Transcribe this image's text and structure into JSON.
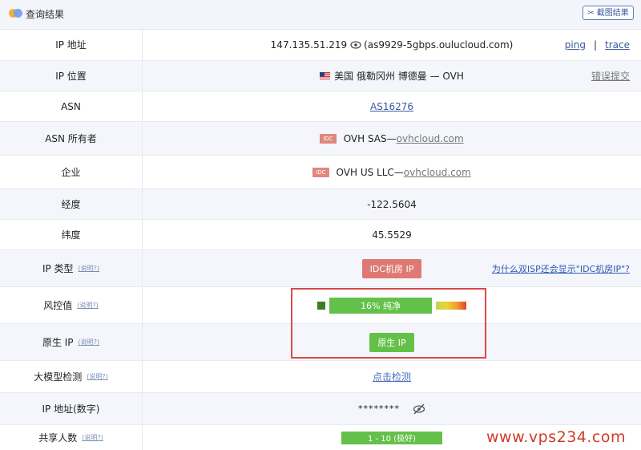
{
  "header": {
    "title": "查询结果",
    "screenshot_button": "截图结果"
  },
  "rows": {
    "ip": {
      "label": "IP 地址",
      "ip": "147.135.51.219",
      "hostname": "(as9929-5gbps.oulucloud.com)",
      "ping": "ping",
      "separator": "|",
      "trace": "trace"
    },
    "location": {
      "label": "IP 位置",
      "value": "美国 俄勒冈州 博德曼 — OVH",
      "report": "错误提交"
    },
    "asn": {
      "label": "ASN",
      "value": "AS16276"
    },
    "asn_owner": {
      "label": "ASN 所有者",
      "tag": "IDC",
      "name": "OVH SAS—",
      "site": "ovhcloud.com"
    },
    "company": {
      "label": "企业",
      "tag": "IDC",
      "name": "OVH US LLC—",
      "site": "ovhcloud.com"
    },
    "longitude": {
      "label": "经度",
      "value": "-122.5604"
    },
    "latitude": {
      "label": "纬度",
      "value": "45.5529"
    },
    "ip_type": {
      "label": "IP 类型",
      "sub": "(说明?)",
      "badge": "IDC机房 IP",
      "why": "为什么双ISP还会显示\"IDC机房IP\"?"
    },
    "risk": {
      "label": "风控值",
      "sub": "(说明?)",
      "text": "16%  纯净",
      "percent": 16
    },
    "native": {
      "label": "原生 IP",
      "sub": "(说明?)",
      "badge": "原生 IP"
    },
    "llm": {
      "label": "大模型检测",
      "sub": "(说明?)",
      "link": "点击检测"
    },
    "ip_numeric": {
      "label": "IP 地址(数字)",
      "value": "********"
    },
    "shared": {
      "label": "共享人数",
      "sub": "(说明?)",
      "value": "1 - 10 (极好)"
    }
  },
  "watermark": "www.vps234.com",
  "colors": {
    "accent": "#3a5aa0",
    "good": "#63c14a",
    "idc": "#de7a73",
    "highlight": "#d94a4a"
  },
  "icons": [
    "logo-icon",
    "scissors-icon",
    "eye-icon",
    "us-flag-icon",
    "eye-off-icon"
  ]
}
